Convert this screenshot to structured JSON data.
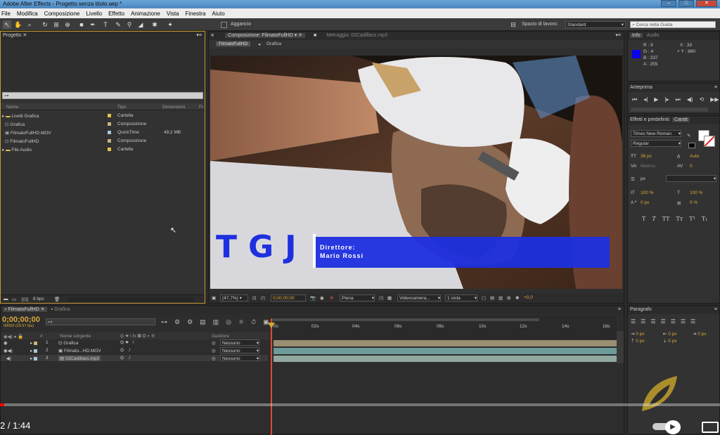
{
  "window": {
    "title": "Adobe After Effects - Progetto senza titolo.aep *"
  },
  "menu": [
    "File",
    "Modifica",
    "Composizione",
    "Livello",
    "Effetto",
    "Animazione",
    "Vista",
    "Finestra",
    "Aiuto"
  ],
  "toolbar": {
    "snap_label": "Aggancio",
    "workspace_label": "Spazio di lavoro:",
    "workspace_value": "Standard",
    "search_placeholder": "Cerca nella Guida"
  },
  "project": {
    "tab": "Progetto",
    "search_value": "⌕▾",
    "columns": [
      "Nome",
      "Tipo",
      "Dimensioni",
      "Fr"
    ],
    "items": [
      {
        "name": "Livelli Grafica",
        "type": "Cartella",
        "size": "",
        "color": "#e5c344"
      },
      {
        "name": "Grafica",
        "type": "Composizione",
        "size": "",
        "color": "#c8b37a"
      },
      {
        "name": "FilmatoFullHD.MOV",
        "type": "QuickTime",
        "size": "49,2 MB",
        "color": "#a8c8d8"
      },
      {
        "name": "FilmatoFullHD",
        "type": "Composizione",
        "size": "",
        "color": "#c8b37a"
      },
      {
        "name": "File Audio",
        "type": "Cartella",
        "size": "",
        "color": "#e5c344"
      }
    ],
    "bpc": "8 bpc"
  },
  "comp": {
    "tab": "Composizione: FilmatoFullHD",
    "footage_tab": "Metraggio: 02Cadillacs.mp3",
    "breadcrumbs": [
      "FilmatoFullHD",
      "Grafica"
    ],
    "overlay": {
      "logo": "TGJ",
      "line1": "Direttore:",
      "line2": "Mario Rossi",
      "accent": "#1e2fe0"
    },
    "footer": {
      "zoom": "(47,7%)",
      "time": "0;00;00;00",
      "resolution": "Piena",
      "camera": "Videocamera...",
      "views": "1 vista",
      "exposure": "+0,0"
    }
  },
  "info": {
    "tabs": [
      "Info",
      "Audio"
    ],
    "r": "R : 9",
    "g": "G : 4",
    "b": "B : 237",
    "a": "A : 255",
    "x": "X : 33",
    "y": "+ Y : 860"
  },
  "preview": {
    "tab": "Anteprima"
  },
  "effects": {
    "tab": "Effetti e predefiniti",
    "char_tab": "Caratt",
    "font": "Times New Roman",
    "style": "Regular",
    "size": "36 px",
    "leading": "Auto",
    "kerning": "Metrics",
    "tracking": "0",
    "stroke_unit": "px",
    "vscale": "100 %",
    "hscale": "100 %",
    "baseline": "0 px",
    "tsume": "0 %",
    "styles": [
      "T",
      "T",
      "TT",
      "Tт",
      "T¹",
      "T₁"
    ]
  },
  "paragraph": {
    "tab": "Paragrafo",
    "values": [
      "0 px",
      "0 px",
      "0 px",
      "0 px",
      "0 px"
    ]
  },
  "timeline": {
    "tabs": [
      "FilmatoFullHD",
      "Grafica"
    ],
    "timecode": "0;00;00;00",
    "fps": "00000 (29.97 fps)",
    "search": "⌕▾",
    "header": {
      "src": "Nome sorgente",
      "parent": "Genitore"
    },
    "ticks": [
      "0s",
      "02s",
      "04s",
      "06s",
      "08s",
      "10s",
      "12s",
      "14s",
      "16s"
    ],
    "layers": [
      {
        "num": "1",
        "name": "Grafica",
        "parent": "Nessuno",
        "bar": "#9a8f73",
        "color": "#c8b37a"
      },
      {
        "num": "2",
        "name": "Filmato...HD.MOV",
        "parent": "Nessuno",
        "bar": "#6f9a9a",
        "color": "#a8c8d8"
      },
      {
        "num": "3",
        "name": "02Cadillacs.mp3",
        "parent": "Nessuno",
        "bar": "#90a8a0",
        "color": "#a8c8d8"
      }
    ]
  },
  "video": {
    "time": "2 / 1:44"
  }
}
